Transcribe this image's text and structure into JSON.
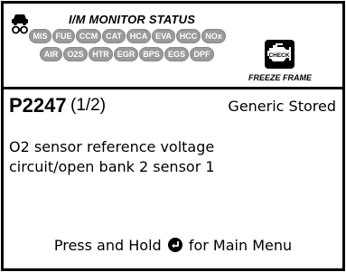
{
  "status": {
    "title": "I/M MONITOR STATUS",
    "monitors_row1": [
      "MIS",
      "FUE",
      "CCM",
      "CAT",
      "HCA",
      "EVA",
      "HCC",
      "NOx"
    ],
    "monitors_row2": [
      "AIR",
      "O2S",
      "HTR",
      "EGR",
      "BPS",
      "EGS",
      "DPF"
    ],
    "check_label": "CHECK",
    "freeze_frame_label": "FREEZE FRAME",
    "icons": [
      "car-icon",
      "check-engine-icon"
    ]
  },
  "dtc": {
    "code": "P2247",
    "index": "(1/2)",
    "type": "Generic Stored",
    "description_line1": "O2 sensor reference voltage",
    "description_line2": "circuit/open bank 2 sensor 1"
  },
  "footer": {
    "prefix": "Press and Hold ",
    "icon": "enter-icon",
    "suffix": " for Main Menu"
  }
}
